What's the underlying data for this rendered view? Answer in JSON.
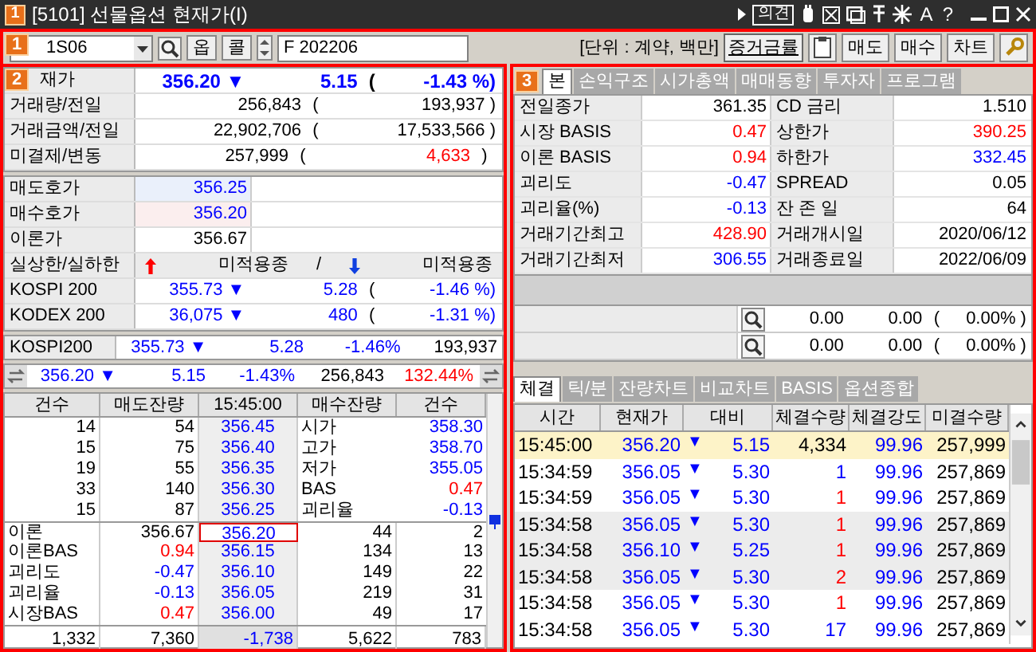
{
  "window": {
    "badge": "1",
    "title": "[5101] 선물옵션 현재가(I)",
    "opinion_button": "의견",
    "font_button": "A",
    "help_button": "?"
  },
  "toolbar": {
    "badge": "1",
    "code": "1S06",
    "option_button": "옵",
    "call_button": "콜",
    "name": "F 202206",
    "unit": "[단위 : 계약, 백만]",
    "margin_button": "증거금률",
    "trade_buttons": [
      "매도",
      "매수",
      "차트"
    ]
  },
  "quote_panel": {
    "badge": "2",
    "summary": [
      {
        "label": "재가",
        "cells": [
          {
            "text": "356.20 ▼",
            "color": "#0000ff"
          },
          {
            "text": "5.15",
            "color": "#0000ff"
          },
          {
            "text": "(",
            "kind": "paren"
          },
          {
            "text": "-1.43 %)",
            "color": "#0000ff"
          }
        ]
      },
      {
        "label": "거래량/전일",
        "cells": [
          {
            "text": "256,843"
          },
          {
            "text": "(",
            "kind": "paren"
          },
          {
            "text": "193,937 )"
          }
        ]
      },
      {
        "label": "거래금액/전일",
        "cells": [
          {
            "text": "22,902,706"
          },
          {
            "text": "(",
            "kind": "paren"
          },
          {
            "text": "17,533,566 )"
          }
        ]
      },
      {
        "label": "미결제/변동",
        "cells": [
          {
            "text": "257,999"
          },
          {
            "text": "(",
            "kind": "paren"
          },
          {
            "text": "4,633",
            "color": "#ff0000"
          },
          {
            "text": ")",
            "kind": "paren"
          }
        ]
      }
    ],
    "quotes": [
      {
        "label": "매도호가",
        "value": "356.25",
        "kind": "ask",
        "color": "#0000ff"
      },
      {
        "label": "매수호가",
        "value": "356.20",
        "kind": "bid",
        "color": "#0000ff"
      },
      {
        "label": "이론가",
        "value": "356.67",
        "kind": "plain"
      }
    ],
    "limit_row": {
      "label": "실상한/실하한",
      "up_text": "미적용종",
      "separator": "/",
      "down_text": "미적용종"
    },
    "indices": [
      {
        "label": "KOSPI 200",
        "cells": [
          {
            "text": "355.73 ▼",
            "color": "#0000ff"
          },
          {
            "text": "5.28",
            "color": "#0000ff"
          },
          {
            "text": "(",
            "kind": "paren"
          },
          {
            "text": "-1.46 %)",
            "color": "#0000ff"
          }
        ]
      },
      {
        "label": "KODEX 200",
        "cells": [
          {
            "text": "36,075 ▼",
            "color": "#0000ff"
          },
          {
            "text": "480",
            "color": "#0000ff"
          },
          {
            "text": "(",
            "kind": "paren"
          },
          {
            "text": "-1.31 %)",
            "color": "#0000ff"
          }
        ]
      }
    ],
    "index_bar": {
      "label": "KOSPI200",
      "cells": [
        {
          "text": "355.73 ▼",
          "color": "#0000ff"
        },
        {
          "text": "5.28",
          "color": "#0000ff"
        },
        {
          "text": "-1.46%",
          "color": "#0000ff"
        },
        {
          "text": "193,937"
        }
      ]
    },
    "current_bar": {
      "cells": [
        {
          "text": "356.20 ▼",
          "color": "#0000ff"
        },
        {
          "text": "5.15",
          "color": "#0000ff"
        },
        {
          "text": "-1.43%",
          "color": "#0000ff"
        },
        {
          "text": "256,843"
        },
        {
          "text": "132.44%",
          "color": "#ff0000"
        }
      ]
    },
    "orderbook": {
      "columns": [
        "건수",
        "매도잔량",
        "15:45:00",
        "매수잔량",
        "건수"
      ],
      "asks": [
        {
          "count": "14",
          "qty": "54",
          "price": "356.45",
          "label": "시가",
          "value": "358.30",
          "color": "#0000ff"
        },
        {
          "count": "15",
          "qty": "75",
          "price": "356.40",
          "label": "고가",
          "value": "358.70",
          "color": "#0000ff"
        },
        {
          "count": "19",
          "qty": "55",
          "price": "356.35",
          "label": "저가",
          "value": "355.05",
          "color": "#0000ff"
        },
        {
          "count": "33",
          "qty": "140",
          "price": "356.30",
          "label": "BAS",
          "value": "0.47",
          "color": "#ff0000"
        },
        {
          "count": "15",
          "qty": "87",
          "price": "356.25",
          "label": "괴리율",
          "value": "-0.13",
          "color": "#0000ff"
        }
      ],
      "bids": [
        {
          "label": "이론",
          "value": "356.67",
          "price": "356.20",
          "qty": "44",
          "count": "2",
          "highlighted": true
        },
        {
          "label": "이론BAS",
          "value": "0.94",
          "color": "#ff0000",
          "price": "356.15",
          "qty": "134",
          "count": "13",
          "highlighted": false
        },
        {
          "label": "괴리도",
          "value": "-0.47",
          "color": "#0000ff",
          "price": "356.10",
          "qty": "149",
          "count": "22",
          "highlighted": false
        },
        {
          "label": "괴리율",
          "value": "-0.13",
          "color": "#0000ff",
          "price": "356.05",
          "qty": "219",
          "count": "31",
          "highlighted": false
        },
        {
          "label": "시장BAS",
          "value": "0.47",
          "color": "#ff0000",
          "price": "356.00",
          "qty": "49",
          "count": "17",
          "highlighted": false
        }
      ],
      "totals": [
        "1,332",
        "7,360",
        "-1,738",
        "5,622",
        "783"
      ]
    }
  },
  "info_panel": {
    "badge": "3",
    "tabs": [
      {
        "label": "본",
        "selected": true
      },
      {
        "label": "손익구조",
        "selected": false
      },
      {
        "label": "시가총액",
        "selected": false
      },
      {
        "label": "매매동향",
        "selected": false
      },
      {
        "label": "투자자",
        "selected": false
      },
      {
        "label": "프로그램",
        "selected": false
      }
    ],
    "rows": [
      {
        "pairs": [
          {
            "label": "전일종가",
            "value": "361.35"
          },
          {
            "label": "CD 금리",
            "value": "1.510"
          }
        ]
      },
      {
        "pairs": [
          {
            "label": "시장 BASIS",
            "value": "0.47",
            "color": "#ff0000"
          },
          {
            "label": "상한가",
            "value": "390.25",
            "color": "#ff0000"
          }
        ]
      },
      {
        "pairs": [
          {
            "label": "이론 BASIS",
            "value": "0.94",
            "color": "#ff0000"
          },
          {
            "label": "하한가",
            "value": "332.45",
            "color": "#0000ff"
          }
        ]
      },
      {
        "pairs": [
          {
            "label": "괴리도",
            "value": "-0.47",
            "color": "#0000ff"
          },
          {
            "label": "SPREAD",
            "value": "0.05"
          }
        ]
      },
      {
        "pairs": [
          {
            "label": "괴리율(%)",
            "value": "-0.13",
            "color": "#0000ff"
          },
          {
            "label": "잔 존 일",
            "value": "64"
          }
        ]
      },
      {
        "pairs": [
          {
            "label": "거래기간최고",
            "value": "428.90",
            "color": "#ff0000"
          },
          {
            "label": "거래개시일",
            "value": "2020/06/12"
          }
        ]
      },
      {
        "pairs": [
          {
            "label": "거래기간최저",
            "value": "306.55",
            "color": "#0000ff"
          },
          {
            "label": "거래종료일",
            "value": "2022/06/09"
          }
        ]
      }
    ],
    "compare_rows": [
      {
        "cells": [
          {
            "text": "0.00"
          },
          {
            "text": "0.00"
          },
          {
            "text": "(",
            "kind": "paren"
          },
          {
            "text": "0.00% )"
          }
        ]
      },
      {
        "cells": [
          {
            "text": "0.00"
          },
          {
            "text": "0.00"
          },
          {
            "text": "(",
            "kind": "paren"
          },
          {
            "text": "0.00% )"
          }
        ]
      }
    ],
    "trade_tabs": [
      {
        "label": "체결",
        "selected": true
      },
      {
        "label": "틱/분",
        "selected": false
      },
      {
        "label": "잔량차트",
        "selected": false
      },
      {
        "label": "비교차트",
        "selected": false
      },
      {
        "label": "BASIS",
        "selected": false
      },
      {
        "label": "옵션종합",
        "selected": false
      }
    ],
    "trade_columns": [
      "시간",
      "현재가",
      "대비",
      "체결수량",
      "체결강도",
      "미결수량"
    ],
    "trades": [
      {
        "time": "15:45:00",
        "price": "356.20",
        "mark": "▼",
        "change": "5.15",
        "qty": "4,334",
        "strength": "99.96",
        "open_interest": "257,999",
        "selected": true,
        "shaded": false
      },
      {
        "time": "15:34:59",
        "price": "356.05",
        "mark": "▼",
        "change": "5.30",
        "qty": "1",
        "color": "#0000ff",
        "strength": "99.96",
        "open_interest": "257,869",
        "selected": false,
        "shaded": false
      },
      {
        "time": "15:34:59",
        "price": "356.05",
        "mark": "▼",
        "change": "5.30",
        "qty": "1",
        "color": "#ff0000",
        "strength": "99.96",
        "open_interest": "257,869",
        "selected": false,
        "shaded": false
      },
      {
        "time": "15:34:58",
        "price": "356.05",
        "mark": "▼",
        "change": "5.30",
        "qty": "1",
        "color": "#ff0000",
        "strength": "99.96",
        "open_interest": "257,869",
        "selected": false,
        "shaded": true
      },
      {
        "time": "15:34:58",
        "price": "356.10",
        "mark": "▼",
        "change": "5.25",
        "qty": "1",
        "color": "#ff0000",
        "strength": "99.96",
        "open_interest": "257,869",
        "selected": false,
        "shaded": true
      },
      {
        "time": "15:34:58",
        "price": "356.05",
        "mark": "▼",
        "change": "5.30",
        "qty": "2",
        "color": "#ff0000",
        "strength": "99.96",
        "open_interest": "257,869",
        "selected": false,
        "shaded": true
      },
      {
        "time": "15:34:58",
        "price": "356.05",
        "mark": "▼",
        "change": "5.30",
        "qty": "1",
        "color": "#ff0000",
        "strength": "99.96",
        "open_interest": "257,869",
        "selected": false,
        "shaded": false
      },
      {
        "time": "15:34:58",
        "price": "356.05",
        "mark": "▼",
        "change": "5.30",
        "qty": "17",
        "color": "#0000ff",
        "strength": "99.96",
        "open_interest": "257,869",
        "selected": false,
        "shaded": false
      }
    ]
  }
}
